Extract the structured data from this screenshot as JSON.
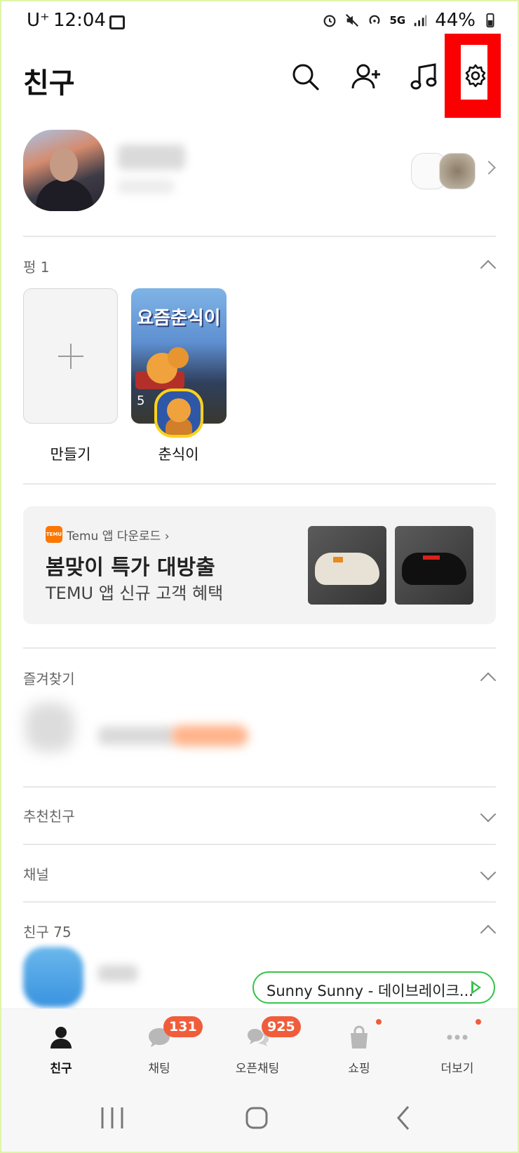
{
  "status_bar": {
    "carrier": "U⁺",
    "time": "12:04",
    "network": "5G",
    "battery": "44%"
  },
  "header": {
    "title": "친구",
    "icons": [
      "search-icon",
      "add-friend-icon",
      "music-icon",
      "settings-icon"
    ],
    "highlight_color": "#fb0000"
  },
  "pang": {
    "label": "펑 1",
    "create_label": "만들기",
    "story": {
      "cover_title": "요즘춘식이",
      "count": "5",
      "name": "춘식이"
    }
  },
  "ad": {
    "logo_text": "TEMU",
    "brand_line": "Temu 앱 다운로드 ›",
    "headline": "봄맞이 특가 대방출",
    "subline": "TEMU 앱 신규 고객 혜택",
    "brand_color": "#fb7701"
  },
  "sections": {
    "favorites": "즐겨찾기",
    "recommended": "추천친구",
    "channels": "채널",
    "friends": "친구 75"
  },
  "music_chip": {
    "text": "Sunny Sunny - 데이브레이크...",
    "color": "#39c24b"
  },
  "tabs": [
    {
      "label": "친구",
      "icon": "person-icon",
      "active": true
    },
    {
      "label": "채팅",
      "icon": "chat-icon",
      "badge": "131"
    },
    {
      "label": "오픈채팅",
      "icon": "open-chat-icon",
      "badge": "925"
    },
    {
      "label": "쇼핑",
      "icon": "shopping-bag-icon",
      "dot": true
    },
    {
      "label": "더보기",
      "icon": "more-icon",
      "dot": true
    }
  ],
  "accent_badge_color": "#f05d3b"
}
